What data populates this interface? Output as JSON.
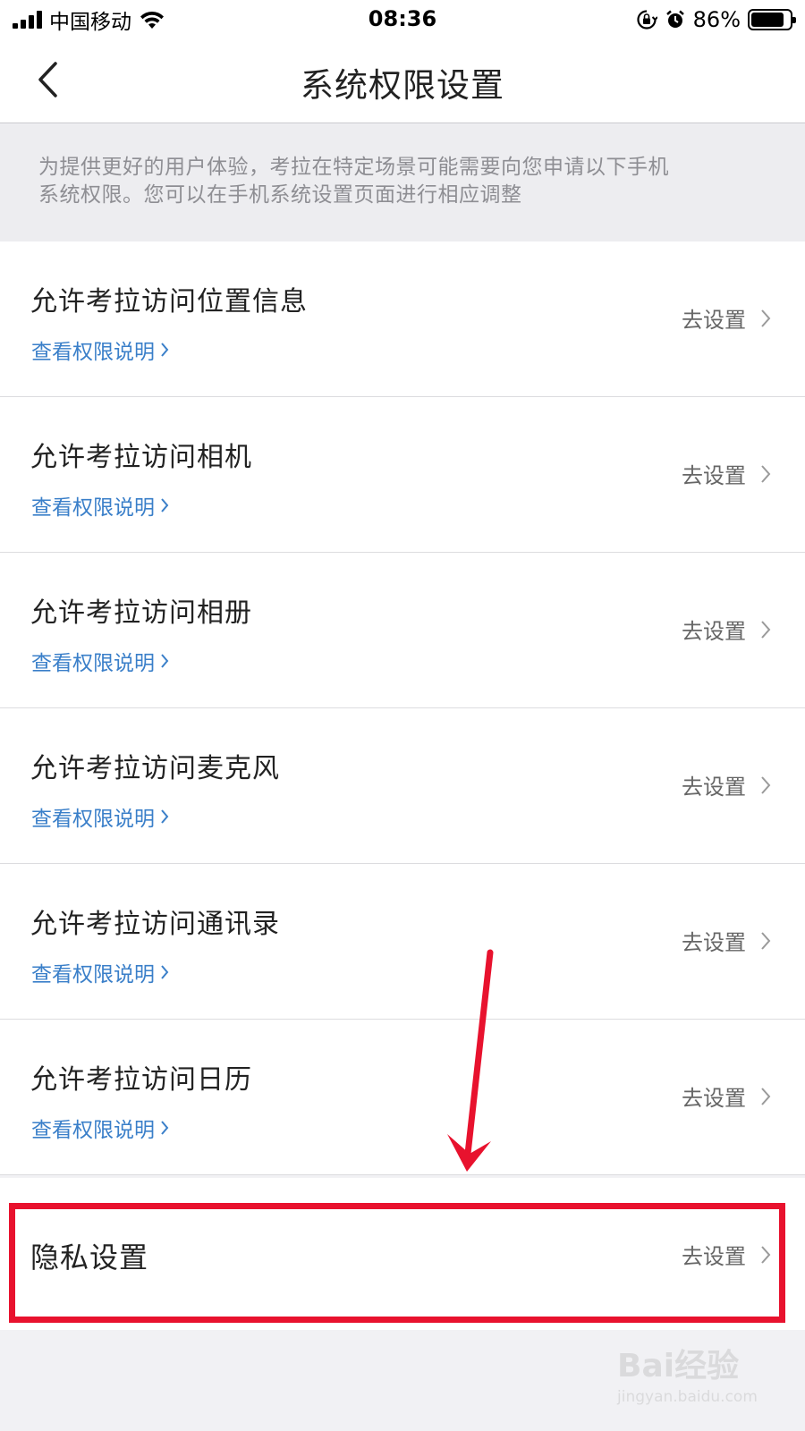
{
  "status_bar": {
    "carrier": "中国移动",
    "time": "08:36",
    "battery_percent": "86%",
    "battery_level": 0.86,
    "icons": [
      "signal-icon",
      "wifi-icon",
      "rotation-lock-icon",
      "alarm-icon",
      "battery-icon"
    ]
  },
  "nav": {
    "title": "系统权限设置",
    "back_icon": "chevron-left-icon"
  },
  "notice": {
    "line1": "为提供更好的用户体验，考拉在特定场景可能需要向您申请以下手机",
    "line2": "系统权限。您可以在手机系统设置页面进行相应调整"
  },
  "permissions": [
    {
      "title": "允许考拉访问位置信息",
      "link": "查看权限说明",
      "action": "去设置"
    },
    {
      "title": "允许考拉访问相机",
      "link": "查看权限说明",
      "action": "去设置"
    },
    {
      "title": "允许考拉访问相册",
      "link": "查看权限说明",
      "action": "去设置"
    },
    {
      "title": "允许考拉访问麦克风",
      "link": "查看权限说明",
      "action": "去设置"
    },
    {
      "title": "允许考拉访问通讯录",
      "link": "查看权限说明",
      "action": "去设置"
    },
    {
      "title": "允许考拉访问日历",
      "link": "查看权限说明",
      "action": "去设置"
    }
  ],
  "privacy": {
    "title": "隐私设置",
    "action": "去设置"
  },
  "annotation": {
    "color": "#e8122e"
  },
  "watermark": {
    "text": "Bai经验",
    "sub": "jingyan.baidu.com"
  }
}
